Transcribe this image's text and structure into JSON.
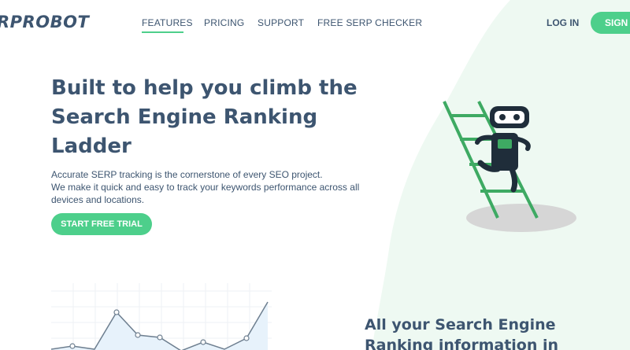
{
  "colors": {
    "accent": "#4dcf8b",
    "text": "#3d5570",
    "blob": "#eef9f2"
  },
  "header": {
    "logo": "RPROBOT",
    "nav": {
      "features": "FEATURES",
      "pricing": "PRICING",
      "support": "SUPPORT",
      "free_serp_checker": "FREE SERP CHECKER"
    },
    "login": "LOG IN",
    "signup": "SIGN U"
  },
  "hero": {
    "title_lines": [
      "Built to help you climb the",
      "Search Engine Ranking",
      "Ladder"
    ],
    "text_lines": [
      "Accurate SERP tracking is the cornerstone of every SEO project.",
      "We make it quick and easy to track your keywords performance across all",
      "devices and locations."
    ],
    "cta": "START FREE TRIAL"
  },
  "illustration": {
    "icon": "robot-climbing-ladder-icon"
  },
  "section": {
    "title_lines": [
      "All your Search Engine",
      "Ranking information in"
    ]
  }
}
